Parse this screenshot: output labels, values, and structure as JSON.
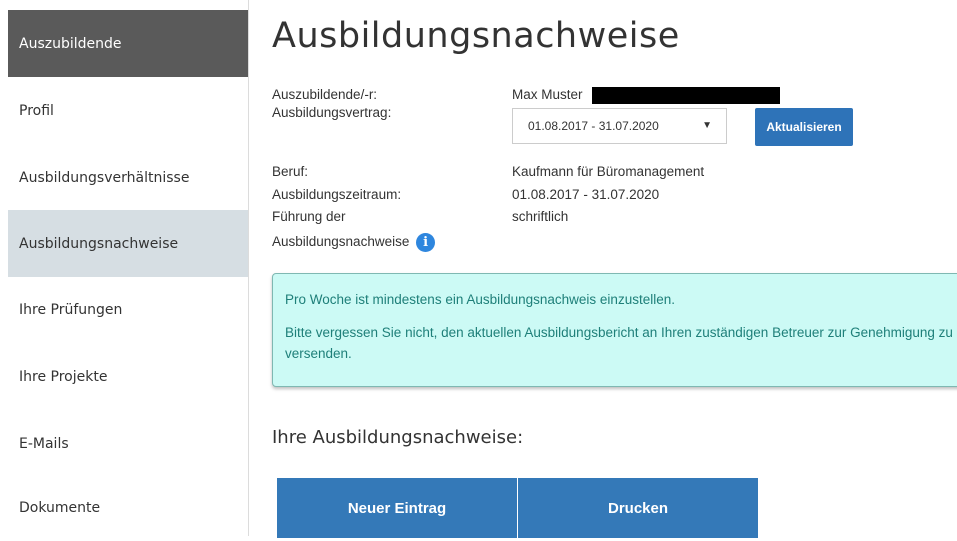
{
  "sidebar": {
    "items": [
      {
        "label": "Auszubildende"
      },
      {
        "label": "Profil"
      },
      {
        "label": "Ausbildungsverhältnisse"
      },
      {
        "label": "Ausbildungsnachweise"
      },
      {
        "label": "Ihre Prüfungen"
      },
      {
        "label": "Ihre Projekte"
      },
      {
        "label": "E-Mails"
      },
      {
        "label": "Dokumente"
      }
    ]
  },
  "page": {
    "title": "Ausbildungsnachweise"
  },
  "details": {
    "trainee_label": "Auszubildende/-r:",
    "trainee_value": "Max Muster",
    "contract_label": "Ausbildungsvertrag:",
    "contract_selected": "01.08.2017 - 31.07.2020",
    "refresh_label": "Aktualisieren",
    "profession_label": "Beruf:",
    "profession_value": "Kaufmann für Büromanagement",
    "period_label": "Ausbildungszeitraum:",
    "period_value": "01.08.2017 - 31.07.2020",
    "mode_label_1": "Führung der",
    "mode_label_2": "Ausbildungsnachweise",
    "mode_value": "schriftlich"
  },
  "alert": {
    "line1": "Pro Woche ist mindestens ein Ausbildungsnachweis einzustellen.",
    "line2": "Bitte vergessen Sie nicht, den aktuellen Ausbildungsbericht an Ihren zuständigen Betreuer zur Genehmigung zu versenden."
  },
  "records": {
    "heading": "Ihre Ausbildungsnachweise:",
    "new_entry_label": "Neuer Eintrag",
    "print_label": "Drucken"
  },
  "colors": {
    "sidebar_dark": "#5a5a5a",
    "sidebar_active": "#d6dee3",
    "primary_button": "#2e73b8",
    "alert_bg": "#ccfaf5",
    "alert_text": "#1e7f79"
  }
}
